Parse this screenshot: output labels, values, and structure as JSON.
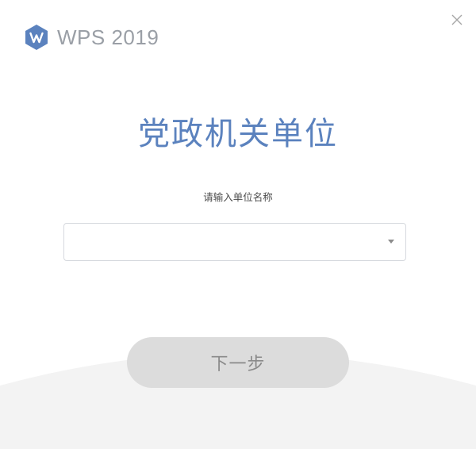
{
  "app": {
    "logo_text": "WPS 2019",
    "logo_icon": "wps-logo-icon",
    "close_icon": "close-icon"
  },
  "main": {
    "title": "党政机关单位",
    "prompt": "请输入单位名称",
    "unit_select": {
      "value": "",
      "icon": "chevron-down-icon"
    },
    "next_button_label": "下一步",
    "next_button_enabled": false
  },
  "colors": {
    "title": "#5b82be",
    "logo_icon": "#5b82be",
    "logo_text": "#9a9fa6",
    "button_disabled_bg": "#dcdcdc",
    "button_disabled_text": "#8a8a8a",
    "footer_bg": "#f3f3f3"
  }
}
